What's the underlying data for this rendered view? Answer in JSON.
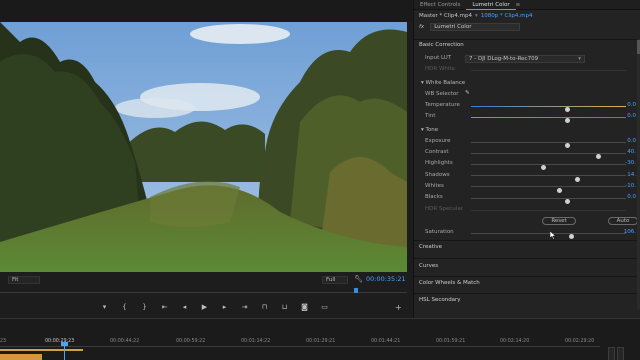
{
  "panel": {
    "tabs": [
      "Effect Controls",
      "Lumetri Color"
    ],
    "tab_menu_icon": "menu-lines-icon",
    "master_label": "Master * Clip4.mp4",
    "clip_label": "1080p * Clip4.mp4",
    "fx_label": "fx",
    "effect_name": "Lumetri Color",
    "basic_correction": "Basic Correction",
    "input_lut_label": "Input LUT",
    "input_lut_value": "7 - DJI DLog-M-to-Rec709",
    "hdr_white_label": "HDR White",
    "white_balance": "White Balance",
    "wb_selector": "WB Selector",
    "tone": "Tone",
    "saturation_label": "Saturation",
    "saturation_value": "106.",
    "reset": "Reset",
    "auto": "Auto",
    "hdr_specular": "HDR Specular",
    "sections": [
      "Creative",
      "Curves",
      "Color Wheels & Match",
      "HSL Secondary"
    ],
    "wb_rows": [
      {
        "label": "Temperature",
        "value": "0.0",
        "pos": 0.62
      },
      {
        "label": "Tint",
        "value": "0.0",
        "pos": 0.62
      }
    ],
    "tone_rows": [
      {
        "label": "Exposure",
        "value": "0.0",
        "pos": 0.62
      },
      {
        "label": "Contrast",
        "value": "40.",
        "pos": 0.82
      },
      {
        "label": "Highlights",
        "value": "-30.",
        "pos": 0.47
      },
      {
        "label": "Shadows",
        "value": "14.",
        "pos": 0.69
      },
      {
        "label": "Whites",
        "value": "-10.",
        "pos": 0.57
      },
      {
        "label": "Blacks",
        "value": "0.0",
        "pos": 0.62
      }
    ],
    "saturation_pos": 0.65
  },
  "monitor": {
    "fit": "Fit",
    "quality": "Full",
    "timecode": "00:00:35:21",
    "playhead_fraction": 0.87,
    "transport_icons": [
      "marker-icon",
      "mark-in-icon",
      "mark-out-icon",
      "go-to-in-icon",
      "step-back-icon",
      "play-icon",
      "step-forward-icon",
      "go-to-out-icon",
      "insert-icon",
      "overwrite-icon",
      "export-frame-icon",
      "button-editor-icon"
    ]
  },
  "timeline": {
    "times": [
      "23",
      "00:00:29:23",
      "00:00:44:22",
      "00:00:59:22",
      "00:01:14:22",
      "00:01:29:21",
      "00:01:44:21",
      "00:01:59:21",
      "00:02:14:20",
      "00:02:29:20"
    ]
  },
  "colors": {
    "accent": "#4aa3ff",
    "clip": "#d7963c",
    "panel_bg": "#232323"
  }
}
